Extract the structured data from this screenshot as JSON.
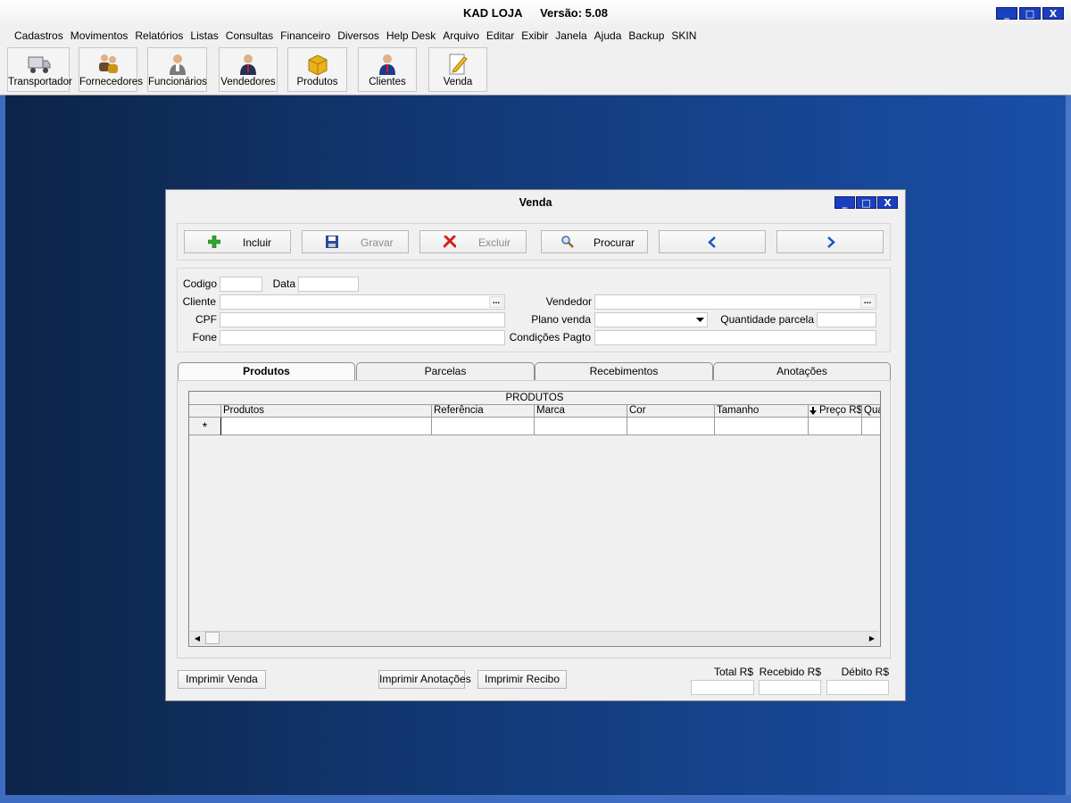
{
  "app": {
    "title": "KAD LOJA",
    "version": "Versão: 5.08",
    "window_buttons": {
      "min": "_",
      "max": "□",
      "close": "X"
    }
  },
  "menu": [
    "Cadastros",
    "Movimentos",
    "Relatórios",
    "Listas",
    "Consultas",
    "Financeiro",
    "Diversos",
    "Help Desk",
    "Arquivo",
    "Editar",
    "Exibir",
    "Janela",
    "Ajuda",
    "Backup",
    "SKIN"
  ],
  "toolbar": {
    "transportador": "Transportador",
    "fornecedores": "Fornecedores",
    "funcionarios": "Funcionários",
    "vendedores": "Vendedores",
    "produtos": "Produtos",
    "clientes": "Clientes",
    "venda": "Venda"
  },
  "dialog": {
    "title": "Venda",
    "actions": {
      "incluir": "Incluir",
      "gravar": "Gravar",
      "excluir": "Excluir",
      "procurar": "Procurar"
    },
    "fields": {
      "codigo": "Codigo",
      "data": "Data",
      "cliente": "Cliente",
      "cpf": "CPF",
      "fone": "Fone",
      "vendedor": "Vendedor",
      "plano_venda": "Plano venda",
      "quantidade_parcela": "Quantidade parcela",
      "condicoes_pagto": "Condições Pagto",
      "ellipsis": "..."
    },
    "tabs": [
      "Produtos",
      "Parcelas",
      "Recebimentos",
      "Anotações"
    ],
    "grid": {
      "caption": "PRODUTOS",
      "columns": [
        "Produtos",
        "Referência",
        "Marca",
        "Cor",
        "Tamanho",
        "Preço R$",
        "Qua"
      ],
      "new_row_marker": "*"
    },
    "bottom": {
      "imprimir_venda": "Imprimir Venda",
      "imprimir_anotacoes": "Imprimir Anotações",
      "imprimir_recibo": "Imprimir Recibo",
      "total": "Total R$",
      "recebido": "Recebido R$",
      "debito": "Débito R$"
    }
  },
  "colors": {
    "accent": "#1c3fbf",
    "desktop_dark": "#0d2448",
    "desktop_light": "#1a4fa8"
  }
}
